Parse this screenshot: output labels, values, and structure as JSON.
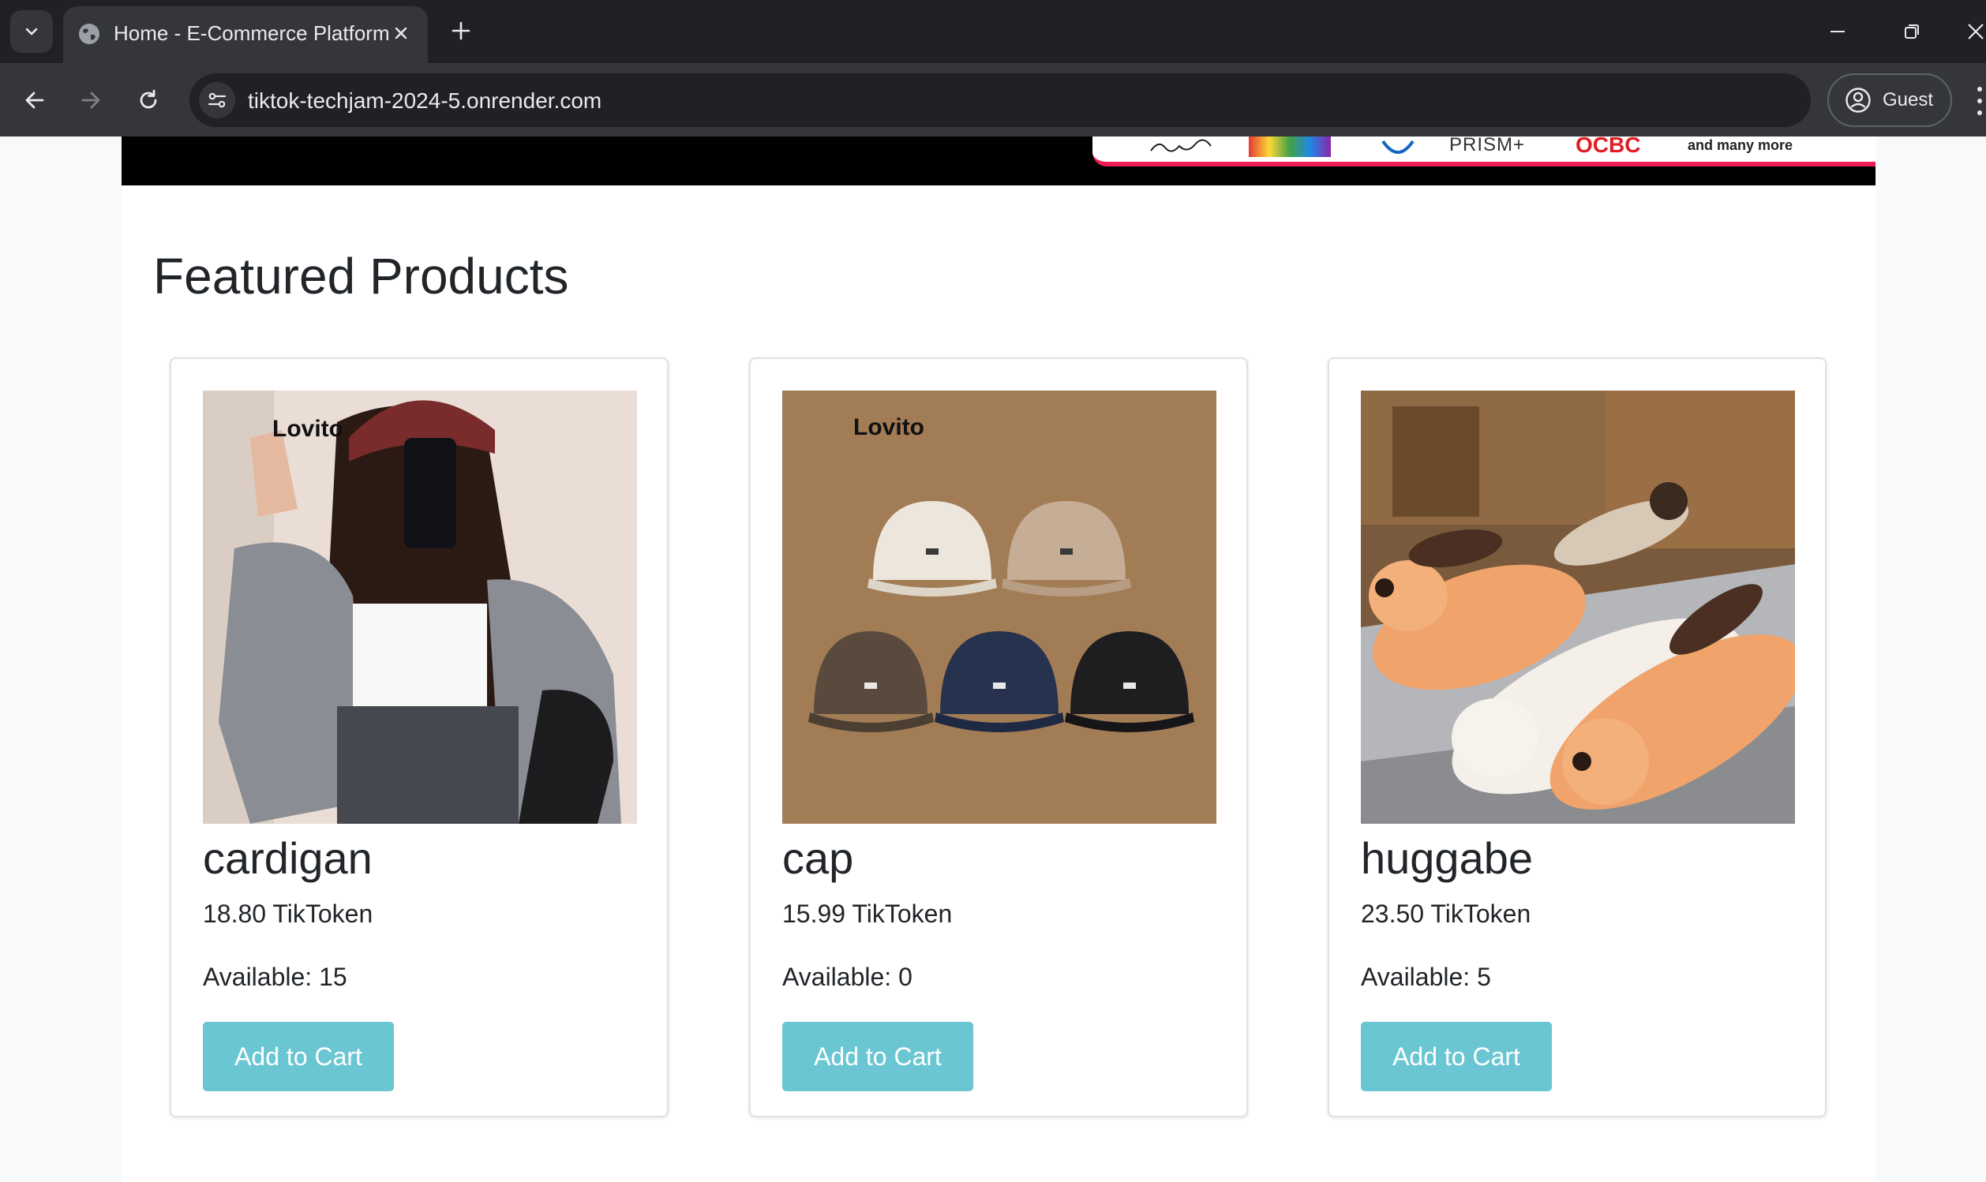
{
  "browser": {
    "tab_title": "Home - E-Commerce Platform",
    "url": "tiktok-techjam-2024-5.onrender.com",
    "profile_label": "Guest"
  },
  "banner": {
    "sponsors": [
      "PRISM+",
      "OCBC",
      "and many more"
    ]
  },
  "page": {
    "section_title": "Featured Products"
  },
  "products": [
    {
      "name": "cardigan",
      "price": "18.80 TikToken",
      "stock": "Available: 15",
      "button": "Add to Cart",
      "image_brand": "Lovito"
    },
    {
      "name": "cap",
      "price": "15.99 TikToken",
      "stock": "Available: 0",
      "button": "Add to Cart",
      "image_brand": "Lovito"
    },
    {
      "name": "huggabe",
      "price": "23.50 TikToken",
      "stock": "Available: 5",
      "button": "Add to Cart"
    }
  ],
  "colors": {
    "button": "#6ac6d2",
    "chrome_dark": "#202124",
    "chrome_mid": "#35363a",
    "accent_red": "#ee1d52"
  }
}
